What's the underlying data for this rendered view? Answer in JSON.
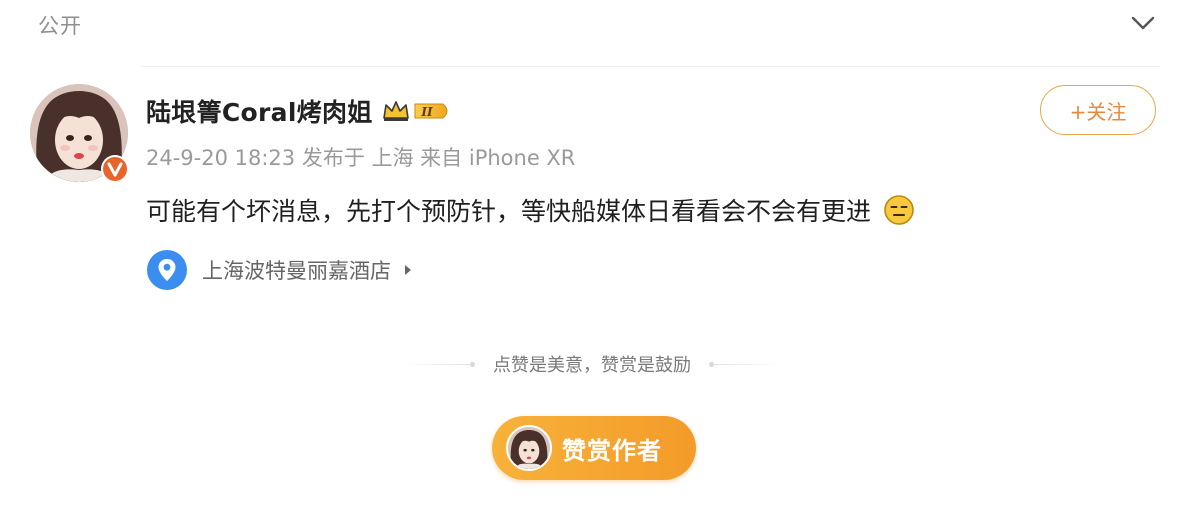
{
  "header": {
    "visibility_label": "公开",
    "collapse_icon": "chevron-down-icon"
  },
  "author": {
    "name": "陆垠箐Coral烤肉姐",
    "avatar_icon": "user-avatar",
    "verified_icon": "verified-v-badge",
    "crown_icon": "vip-crown-icon",
    "level_badge_text": "II",
    "follow_label": "+关注"
  },
  "post": {
    "meta": "24-9-20 18:23 发布于 上海 来自 iPhone XR",
    "text": "可能有个坏消息，先打个预防针，等快船媒体日看看会不会有更进",
    "emoji_icon": "expressionless-face-emoji",
    "location_icon": "map-pin-icon",
    "location": "上海波特曼丽嘉酒店"
  },
  "reward": {
    "slogan": "点赞是美意，赞赏是鼓励",
    "button_label": "赞赏作者"
  },
  "colors": {
    "accent_orange": "#f49b2a",
    "follow_border": "#e8a74a",
    "follow_text": "#e8893a",
    "meta_gray": "#9a9a9a",
    "location_blue": "#3b8ef0",
    "verified_orange": "#e8642c"
  }
}
